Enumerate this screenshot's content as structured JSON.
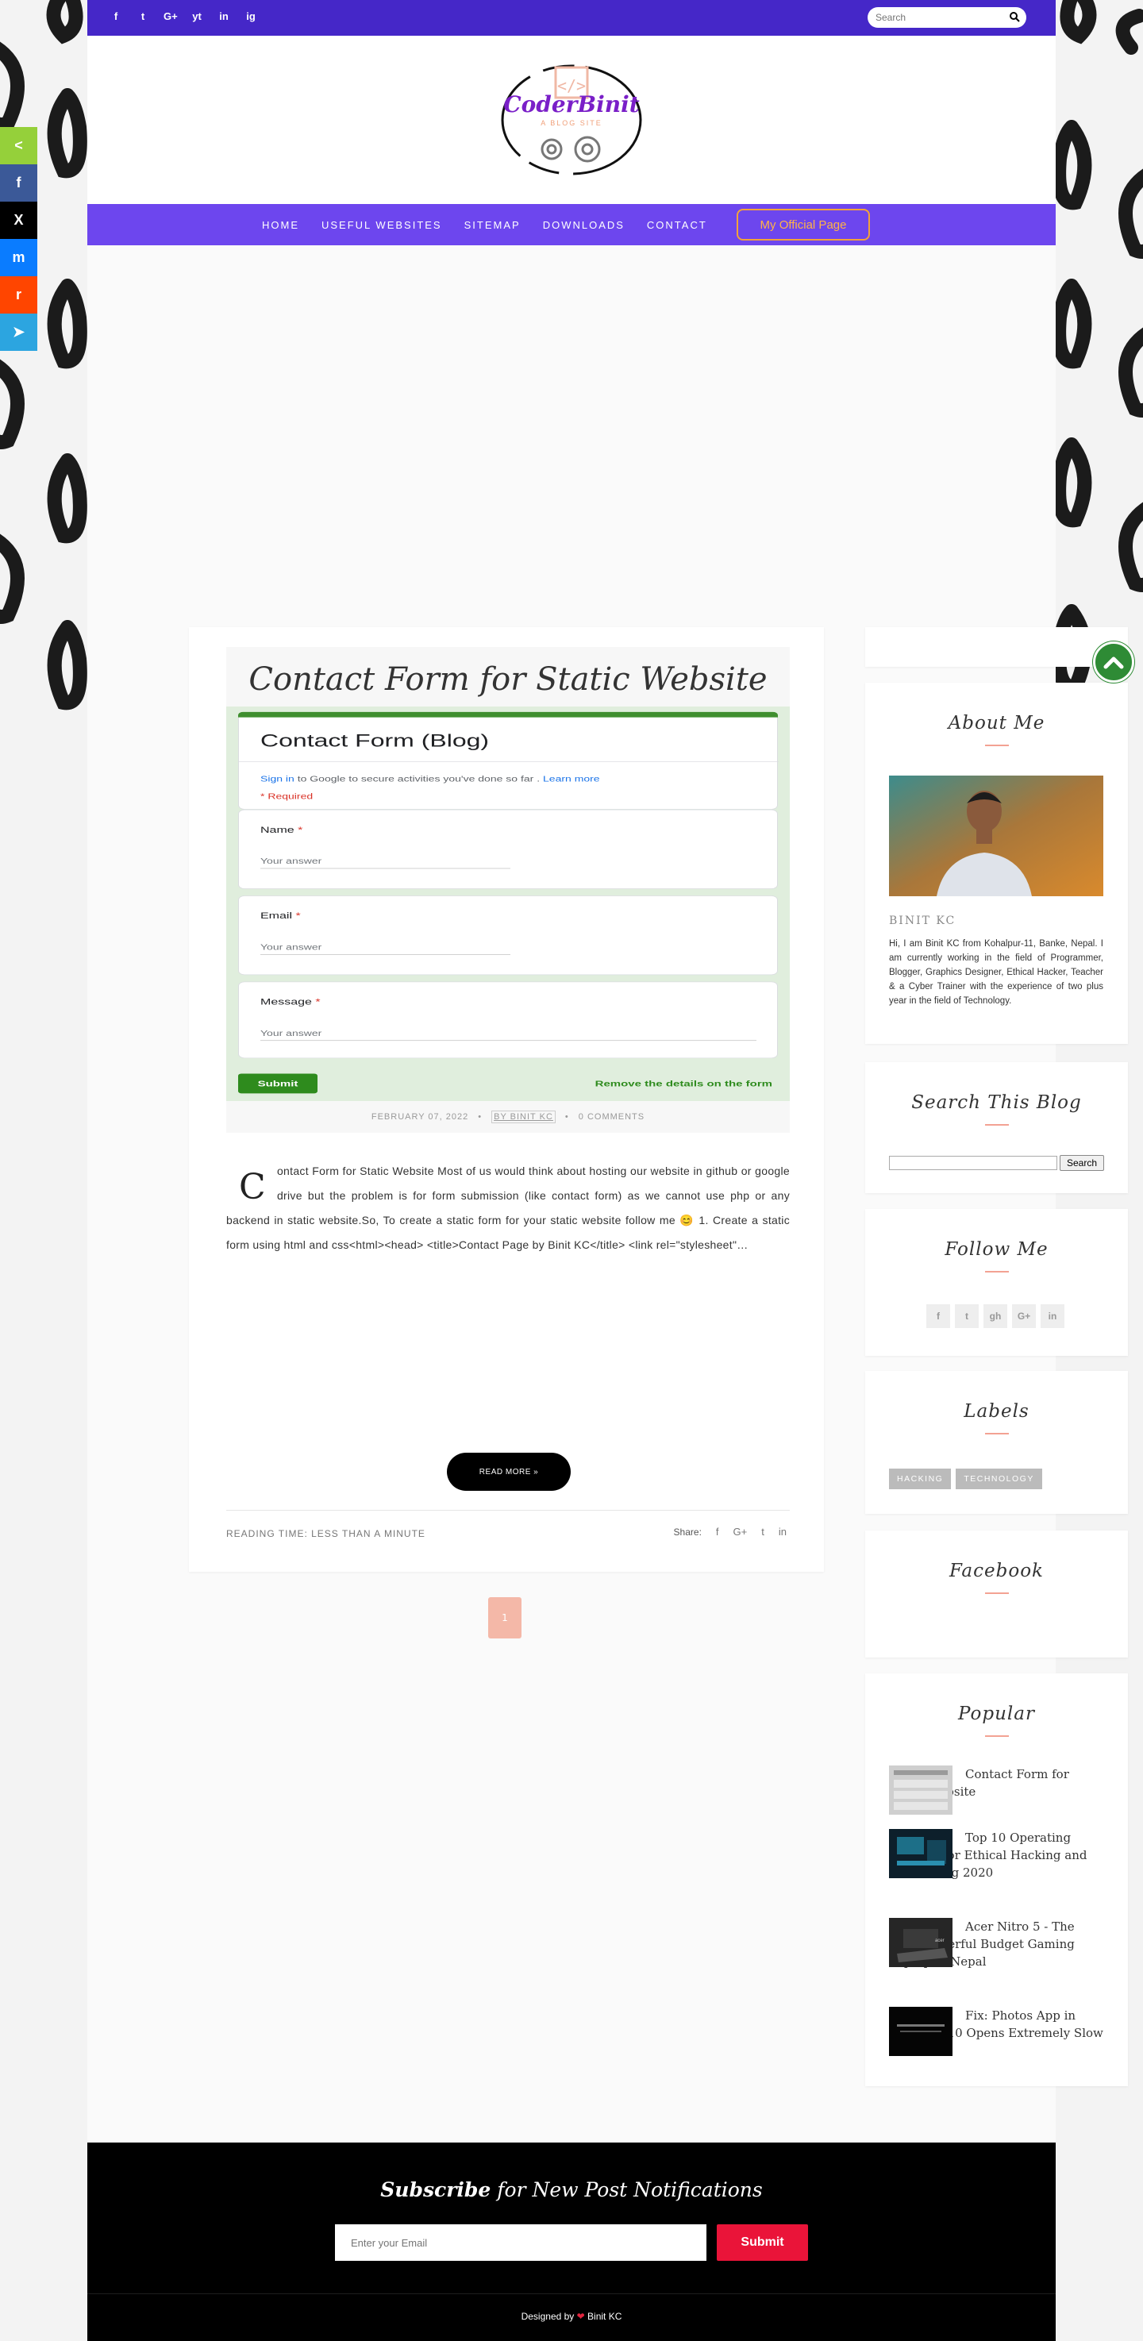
{
  "topbar": {
    "social": [
      "f",
      "t",
      "G+",
      "yt",
      "in",
      "ig"
    ],
    "social_icons": [
      "facebook-icon",
      "twitter-icon",
      "google-plus-icon",
      "youtube-icon",
      "linkedin-icon",
      "instagram-icon"
    ],
    "search_placeholder": "Search"
  },
  "logo": {
    "name": "CoderBinit",
    "tagline": "A BLOG SITE",
    "code_mark": "</>"
  },
  "nav": {
    "items": [
      "HOME",
      "USEFUL WEBSITES",
      "SITEMAP",
      "DOWNLOADS",
      "CONTACT"
    ],
    "official_button": "My Official Page"
  },
  "share_sidebar": {
    "icons": [
      "share-icon",
      "facebook-icon",
      "x-icon",
      "messenger-icon",
      "reddit-icon",
      "telegram-icon"
    ],
    "glyphs": [
      "<",
      "f",
      "X",
      "m",
      "r",
      "➤"
    ],
    "colors": [
      "#95d03a",
      "#3b5998",
      "#000000",
      "#0a7cff",
      "#ff4500",
      "#2ca5e0"
    ]
  },
  "post": {
    "title": "Contact Form for Static Website",
    "form_image": {
      "title": "Contact Form (Blog)",
      "sign_in_link": "Sign in",
      "sign_in_text": " to Google to secure activities you've done so far . ",
      "learn_more": "Learn more",
      "required": "* Required",
      "questions": [
        {
          "label": "Name",
          "star": "*",
          "placeholder": "Your answer"
        },
        {
          "label": "Email",
          "star": "*",
          "placeholder": "Your answer"
        },
        {
          "label": "Message",
          "star": "*",
          "placeholder": "Your answer"
        }
      ],
      "submit": "Submit",
      "remove_note": "Remove the details on the form"
    },
    "date": "FEBRUARY 07, 2022",
    "author": "BY BINIT KC",
    "comments": "0 COMMENTS",
    "dropcap": "C",
    "excerpt": "ontact Form for Static Website Most of us would think about hosting our website in github or google drive but the problem is for form submission (like contact form) as we cannot use php or any backend in static website.So, To create a static form for your static website follow me 😊     1. Create a static form using html and css<html><head>  <title>Contact Page by Binit KC</title>  <link rel=\"stylesheet\"…",
    "read_more": "READ MORE »",
    "reading_time": "READING TIME: LESS THAN A MINUTE",
    "share_label": "Share:",
    "share_icons": [
      "facebook-icon",
      "google-plus-icon",
      "twitter-icon",
      "linkedin-icon"
    ],
    "share_glyphs": [
      "f",
      "G+",
      "t",
      "in"
    ]
  },
  "pager": {
    "current": "1"
  },
  "sidebar": {
    "about": {
      "title": "About Me",
      "name": "BINIT KC",
      "text": "Hi, I am Binit KC from Kohalpur-11, Banke, Nepal. I am currently working in the field of Programmer, Blogger, Graphics Designer, Ethical Hacker, Teacher & a Cyber Trainer with the experience of two plus year in the field of Technology."
    },
    "search": {
      "title": "Search This Blog",
      "button": "Search"
    },
    "follow": {
      "title": "Follow Me",
      "icons": [
        "facebook-icon",
        "twitter-icon",
        "github-icon",
        "google-plus-icon",
        "linkedin-icon"
      ],
      "glyphs": [
        "f",
        "t",
        "gh",
        "G+",
        "in"
      ]
    },
    "labels": {
      "title": "Labels",
      "items": [
        "HACKING",
        "TECHNOLOGY"
      ]
    },
    "facebook": {
      "title": "Facebook"
    },
    "popular": {
      "title": "Popular",
      "items": [
        "Contact Form for Static Website",
        "Top 10 Operating Systems for Ethical Hacking and Pen Testing 2020",
        "Acer Nitro 5 - The Most Powerful Budget Gaming Laptop in Nepal",
        "Fix: Photos App in Windows 10 Opens Extremely Slow"
      ]
    }
  },
  "footer": {
    "subscribe_bold": "Subscribe",
    "subscribe_rest": " for New Post Notifications",
    "email_placeholder": "Enter your Email",
    "submit": "Submit",
    "designed_prefix": "Designed by ",
    "heart": "❤",
    "designed_name": " Binit KC"
  },
  "colors": {
    "topbar": "#4527c8",
    "nav": "#6d46ee",
    "accent_line": "#f3a293",
    "subscribe_button": "#ea1439",
    "go_top": "#2e8b35"
  }
}
